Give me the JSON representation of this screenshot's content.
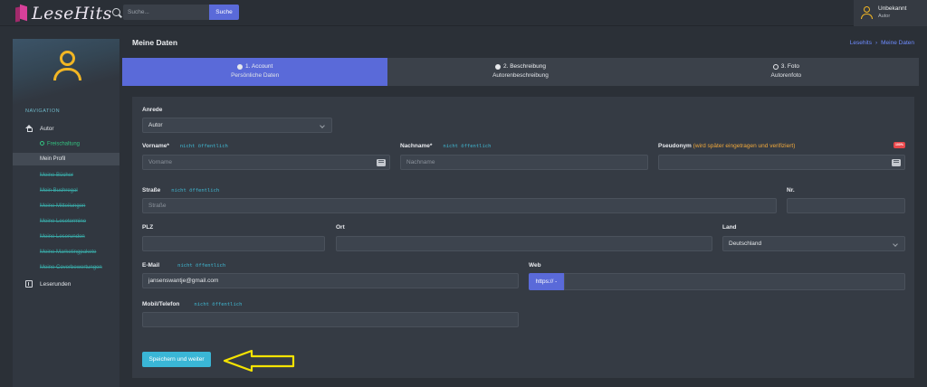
{
  "header": {
    "logo_text": "LeseHits",
    "search": {
      "placeholder": "Suche...",
      "button_label": "Suche"
    },
    "user": {
      "name": "Unbekannt",
      "role": "Autor"
    }
  },
  "sidebar": {
    "nav_heading": "NAVIGATION",
    "items": [
      {
        "label": "Autor",
        "icon": "home-icon"
      },
      {
        "label": "Freischaltung"
      },
      {
        "label": "Mein Profil"
      },
      {
        "label": "Meine Bücher"
      },
      {
        "label": "Mein Buchregal"
      },
      {
        "label": "Meine Mitteilungen"
      },
      {
        "label": "Meine Lesetermine"
      },
      {
        "label": "Meine Leserunden"
      },
      {
        "label": "Meine Marketingpakete"
      },
      {
        "label": "Meine Coverbewertungen"
      },
      {
        "label": "Leserunden",
        "icon": "book-icon"
      }
    ]
  },
  "page": {
    "title": "Meine Daten",
    "breadcrumb": [
      "Lesehits",
      "›",
      "Meine Daten"
    ]
  },
  "steps": [
    {
      "title": "1. Account",
      "subtitle": "Persönliche Daten",
      "active": true
    },
    {
      "title": "2. Beschreibung",
      "subtitle": "Autorenbeschreibung",
      "active": false
    },
    {
      "title": "3. Foto",
      "subtitle": "Autorenfoto",
      "active": false
    }
  ],
  "form": {
    "anrede": {
      "label": "Anrede",
      "value": "Autor"
    },
    "vorname": {
      "label": "Vorname*",
      "hint": "nicht öffentlich",
      "placeholder": "Vorname"
    },
    "nachname": {
      "label": "Nachname*",
      "hint": "nicht öffentlich",
      "placeholder": "Nachname"
    },
    "pseudonym": {
      "label": "Pseudonym",
      "note": "(wird später eingetragen und verifiziert)",
      "badge": "100%"
    },
    "strasse": {
      "label": "Straße",
      "hint": "nicht öffentlich",
      "placeholder": "Straße"
    },
    "nr": {
      "label": "Nr."
    },
    "plz": {
      "label": "PLZ"
    },
    "ort": {
      "label": "Ort"
    },
    "land": {
      "label": "Land",
      "value": "Deutschland"
    },
    "email": {
      "label": "E-Mail",
      "hint": "nicht öffentlich",
      "value": "jansenswantje@gmail.com"
    },
    "web": {
      "label": "Web",
      "prefix": "https:// -"
    },
    "mobil": {
      "label": "Mobil/Telefon",
      "hint": "nicht öffentlich"
    },
    "submit_label": "Speichern und weiter"
  },
  "colors": {
    "accent": "#5a6ad9",
    "cyan_button": "#3ab6d6",
    "annotation_arrow": "#f5e300",
    "avatar": "#f2b624"
  }
}
